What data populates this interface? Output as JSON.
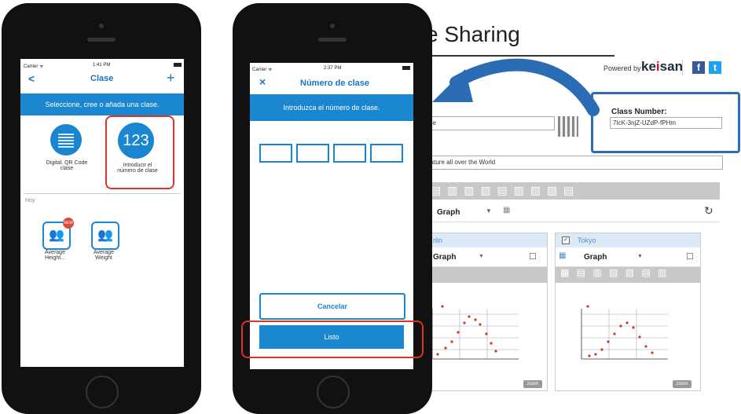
{
  "left_phone": {
    "status": {
      "carrier": "Carrier ᯤ",
      "time": "1:41 PM"
    },
    "nav": {
      "back": "<",
      "title": "Clase",
      "add": "+"
    },
    "banner": "Seleccione, cree o añada una clase.",
    "options": [
      {
        "icon": "qr-code-icon",
        "label": "Digital. QR Code clase"
      },
      {
        "icon_text": "123",
        "label": "Introducir el número de clase"
      }
    ],
    "section": "Hoy",
    "classes": [
      {
        "badge": "NEW",
        "label": "Average Height..."
      },
      {
        "label": "Average Weight"
      }
    ]
  },
  "right_phone": {
    "status": {
      "carrier": "Carrier ᯤ",
      "time": "2:37 PM"
    },
    "nav": {
      "close": "×",
      "title": "Número de clase"
    },
    "banner": "Introduzca el número de clase.",
    "cancel": "Cancelar",
    "ok": "Listo"
  },
  "web": {
    "title": "e Sharing",
    "powered_by": "Powered by",
    "brand_a": "ke",
    "brand_b": "i",
    "brand_c": "san",
    "social_f": "f",
    "social_t": "t",
    "class_number_label": "Class Number:",
    "class_number_value": "7IcK-3njZ-UZdP-fPHm",
    "field1": "perature",
    "field2": "emperature all over the World",
    "graph": "Graph",
    "panel_left": "rlin",
    "panel_right": "Tokyo",
    "panel_graph": "Graph",
    "zoom": "zoom"
  },
  "colors": {
    "accent": "#1a86d0",
    "highlight_red": "#d9342b",
    "highlight_blue": "#2a6db5"
  }
}
